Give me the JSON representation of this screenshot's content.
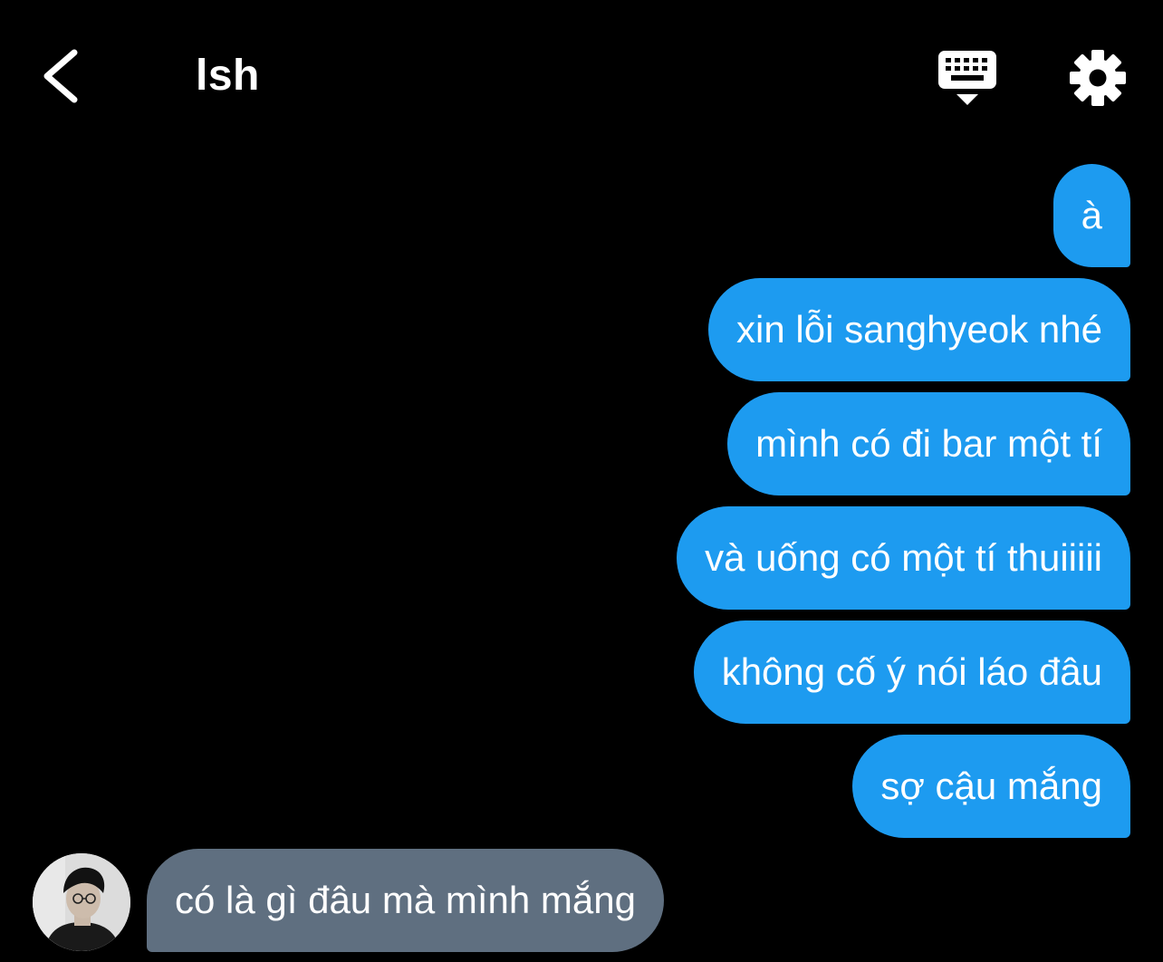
{
  "header": {
    "title": "lsh",
    "back_icon": "chevron-left-icon",
    "keyboard_icon": "keyboard-hide-icon",
    "settings_icon": "gear-icon"
  },
  "colors": {
    "background": "#000000",
    "sent_bubble": "#1d9bf0",
    "received_bubble": "#5f6f80",
    "text": "#ffffff"
  },
  "messages": [
    {
      "from": "me",
      "text": "à"
    },
    {
      "from": "me",
      "text": "xin lỗi sanghyeok nhé"
    },
    {
      "from": "me",
      "text": "mình có đi bar một tí"
    },
    {
      "from": "me",
      "text": "và uống có một tí thuiiiii"
    },
    {
      "from": "me",
      "text": "không cố ý nói láo đâu"
    },
    {
      "from": "me",
      "text": "sợ cậu mắng"
    },
    {
      "from": "other",
      "text": "có là gì đâu mà mình mắng"
    }
  ]
}
